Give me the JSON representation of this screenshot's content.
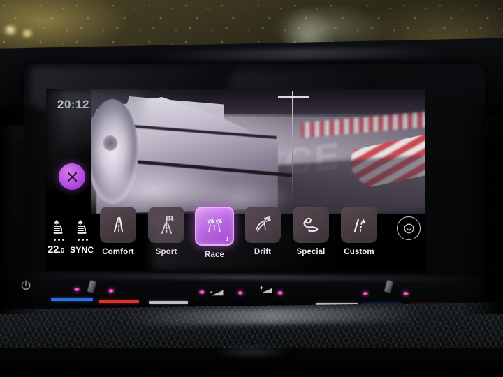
{
  "screen": {
    "clock": "20:12",
    "close_icon": "close-x-icon",
    "climate": {
      "driver_seat_icon": "seat-ventilation-icon",
      "passenger_seat_icon": "seat-ventilation-icon",
      "driver_level_dots": 3,
      "passenger_level_dots": 3,
      "temperature": "22",
      "temperature_decimal": ".0",
      "sync_label": "SYNC"
    },
    "hero": {
      "background_word": "RACE",
      "description": "silver sports car drifting on racetrack with smoke"
    },
    "drive_modes": [
      {
        "label": "Comfort",
        "icon": "road-straight-icon",
        "active": false,
        "chevron": ""
      },
      {
        "label": "Sport",
        "icon": "checkered-flag-road-icon",
        "active": false,
        "chevron": ""
      },
      {
        "label": "Race",
        "icon": "double-checkered-flag-icon",
        "active": true,
        "chevron": "›"
      },
      {
        "label": "Drift",
        "icon": "drift-flag-icon",
        "active": false,
        "chevron": ""
      },
      {
        "label": "Special",
        "icon": "race-circuit-icon",
        "active": false,
        "chevron": ""
      },
      {
        "label": "Custom",
        "icon": "road-star-icon",
        "active": false,
        "chevron": ""
      }
    ],
    "info_button_icon": "down-arrow-circle-icon"
  },
  "hardware": {
    "power_icon": "power-icon",
    "volume_down_icon": "volume-down-icon",
    "volume_up_icon": "volume-up-icon",
    "indicator_colors": {
      "blue": "#2b6fdc",
      "red": "#d8342a",
      "gray": "#b9bcc4",
      "led": "#ff7ae0"
    }
  },
  "theme": {
    "accent": "#bb5ae9",
    "accent_light": "#f0b8ff",
    "tile": "#463a40",
    "text": "#f3f1f6"
  }
}
